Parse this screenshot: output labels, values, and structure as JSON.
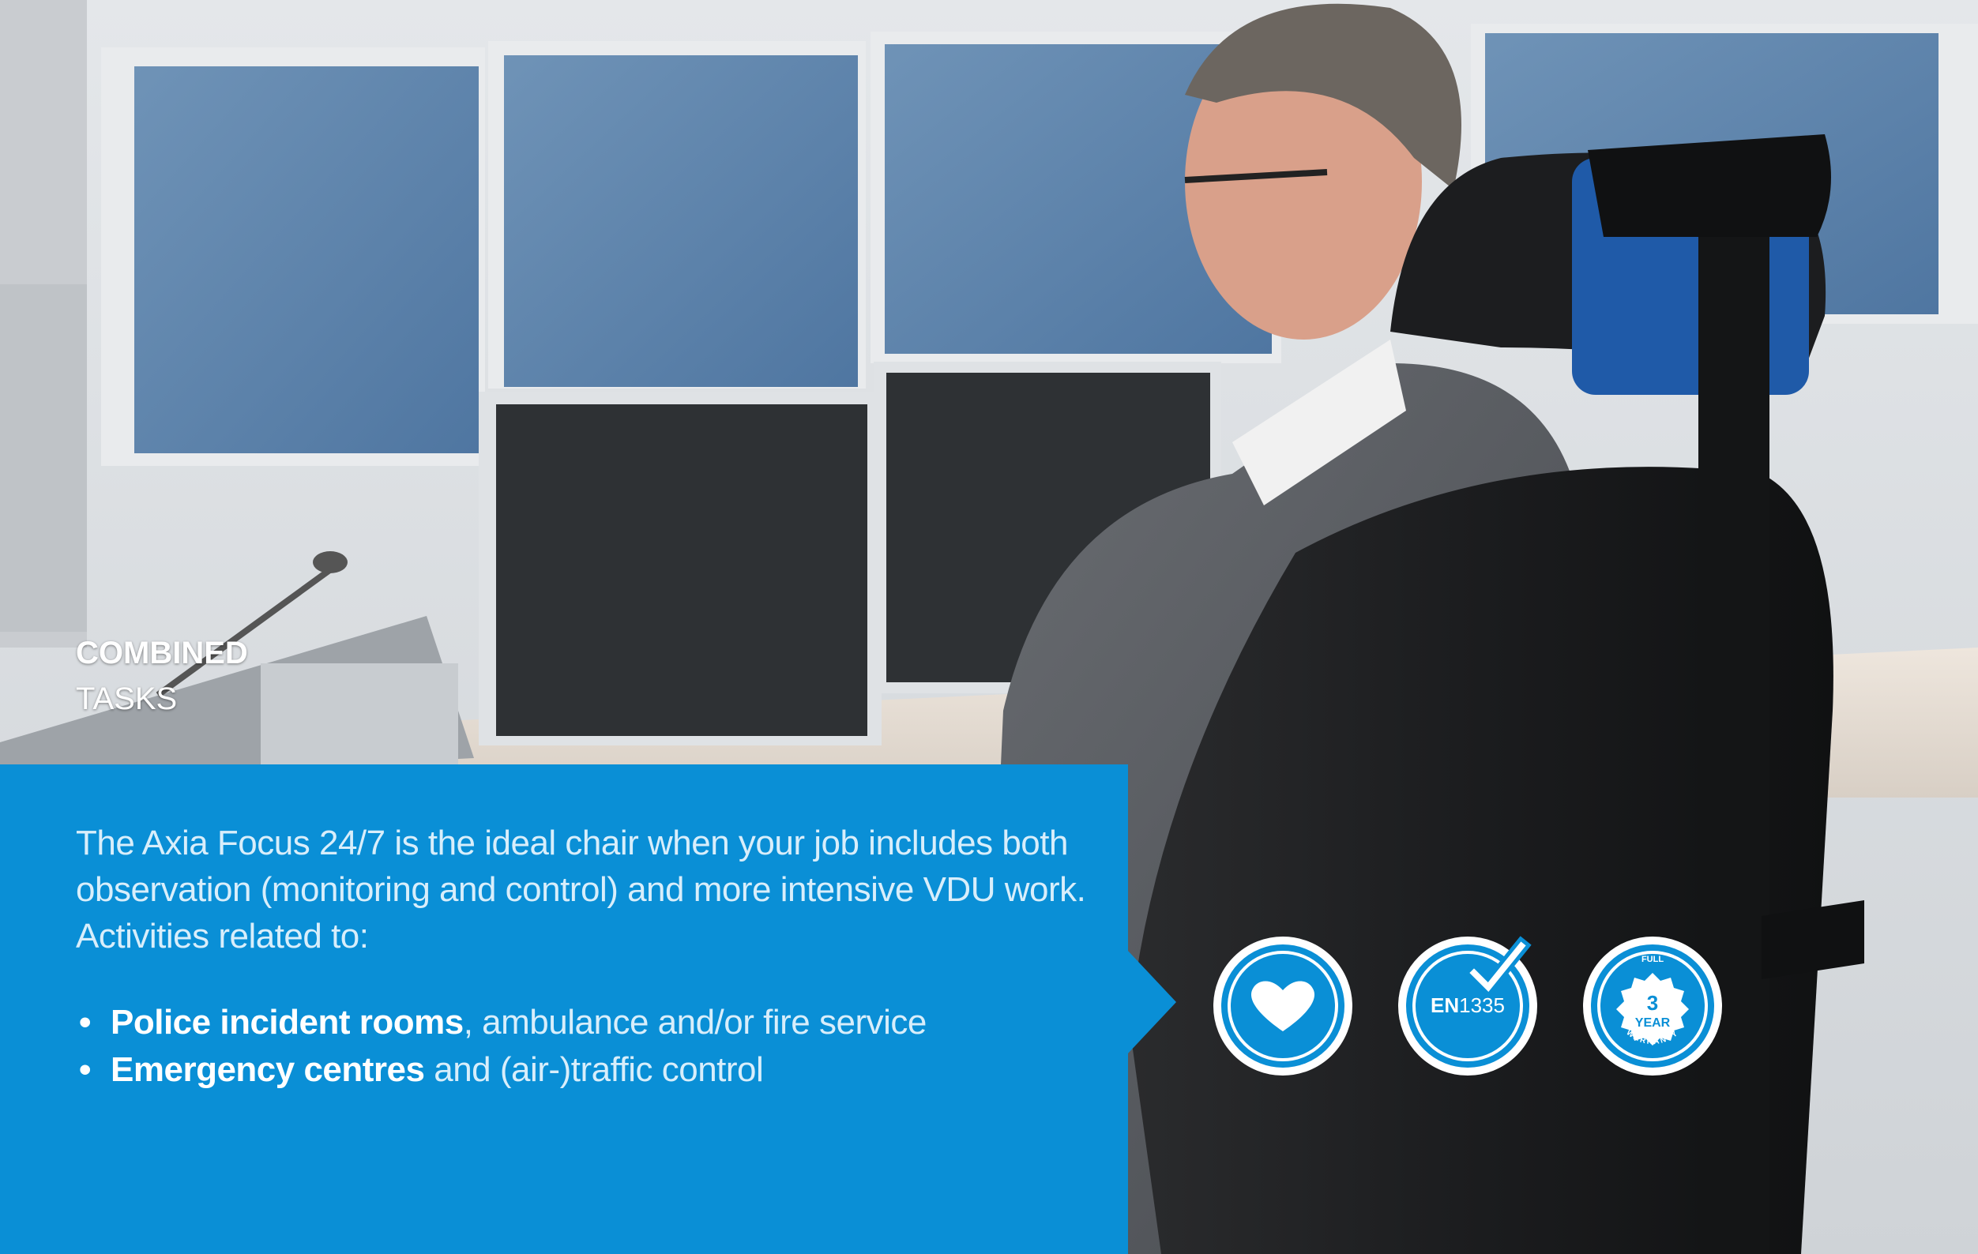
{
  "heading": {
    "line1": "COMBINED",
    "line2": "TASKS"
  },
  "intro": "The Axia Focus 24/7 is the ideal chair when your job includes both observation (monitoring and control) and more intensive VDU work. Activities related to:",
  "bullets": [
    {
      "bold": "Police incident rooms",
      "rest": ", ambulance and/or fire service"
    },
    {
      "bold": "Emergency centres",
      "rest": " and (air-)traffic control"
    }
  ],
  "badges": {
    "heart_icon": "heart-icon",
    "en_prefix": "EN",
    "en_number": "1335",
    "warranty_top": "FULL",
    "warranty_number": "3",
    "warranty_unit": "YEAR",
    "warranty_bottom": "WARRANTY"
  },
  "colors": {
    "panel_blue": "#0a8fd6",
    "text_light": "#d8eefb",
    "white": "#ffffff"
  }
}
